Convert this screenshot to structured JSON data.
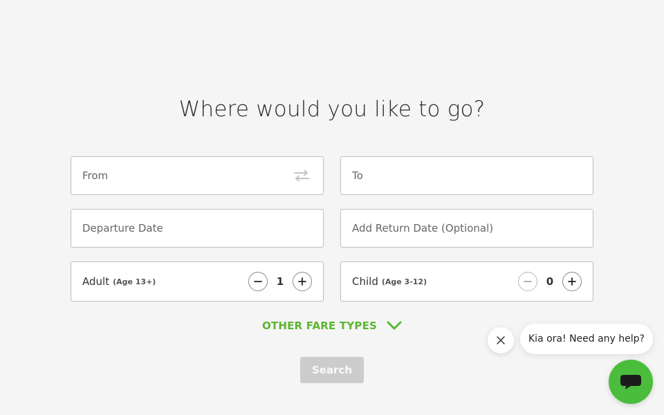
{
  "headline": "Where would you like to go?",
  "from": {
    "placeholder": "From",
    "swap_icon": "swap-arrows-icon"
  },
  "to": {
    "placeholder": "To"
  },
  "departure": {
    "placeholder": "Departure Date"
  },
  "return": {
    "placeholder": "Add Return Date (Optional)"
  },
  "passengers": {
    "adult": {
      "label": "Adult",
      "sublabel": "(Age 13+)",
      "count": "1"
    },
    "child": {
      "label": "Child",
      "sublabel": "(Age 3-12)",
      "count": "0"
    }
  },
  "other_fares": {
    "label": "OTHER FARE TYPES",
    "icon": "chevron-down-icon"
  },
  "search": {
    "label": "Search"
  },
  "chat": {
    "message": "Kia ora! Need any help?",
    "close_icon": "close-icon",
    "launcher_icon": "chat-icon"
  },
  "colors": {
    "accent_green": "#5bb531",
    "launcher_green": "#4bbd3c",
    "disabled_button": "#cccccc",
    "background": "#f5f5f5"
  }
}
